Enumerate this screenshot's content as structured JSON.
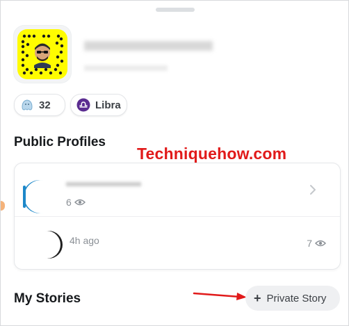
{
  "profile": {
    "snapcode_colors": {
      "code": "#fffc00",
      "frame": "#f3f4f5"
    },
    "count_chip": {
      "icon": "friendship-ghost-icon",
      "value": "32"
    },
    "zodiac_chip": {
      "icon": "libra-icon",
      "label": "Libra"
    }
  },
  "public_profiles": {
    "title": "Public Profiles",
    "items": [
      {
        "views": "6",
        "icon": "eye-icon",
        "action_icon": "chevron-right-icon"
      },
      {
        "time": "4h ago",
        "views": "7",
        "icon": "eye-icon"
      }
    ]
  },
  "watermark": {
    "text": "Techniquehow.com",
    "color": "#e11a1a"
  },
  "my_stories": {
    "title": "My Stories",
    "private_story_button": {
      "icon": "plus-icon",
      "label": "Private Story"
    }
  },
  "colors": {
    "accent": "#1d88c9",
    "secondary_text": "#8b9096",
    "annotation_arrow": "#e11a1a",
    "zodiac_purple": "#5b2d91"
  }
}
